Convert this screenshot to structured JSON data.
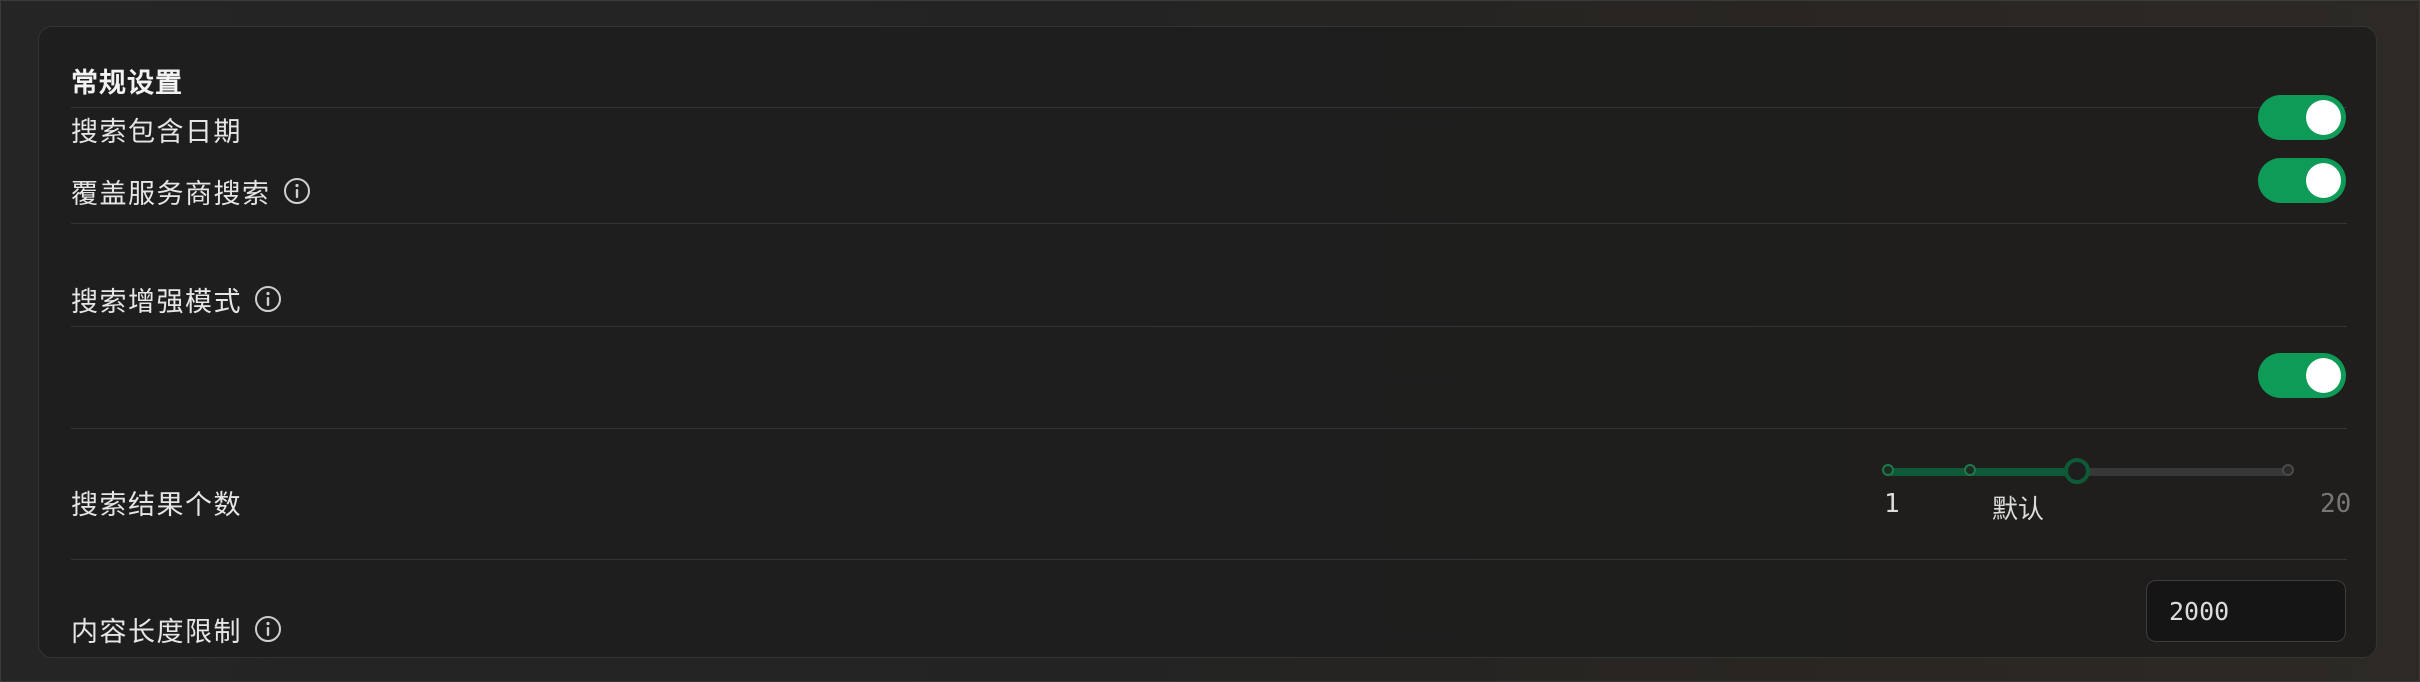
{
  "section": {
    "title": "常规设置"
  },
  "settings": {
    "include_date": {
      "label": "搜索包含日期",
      "enabled": true
    },
    "override_provider": {
      "label": "覆盖服务商搜索",
      "enabled": true
    },
    "enhanced_mode": {
      "label": "搜索增强模式",
      "enabled": true
    },
    "result_count": {
      "label": "搜索结果个数",
      "min_label": "1",
      "default_label": "默认",
      "max_label": "20",
      "slider_fraction": 0.47
    },
    "content_length": {
      "label": "内容长度限制",
      "value": "2000"
    }
  },
  "colors": {
    "accent": "#0e9a57",
    "slider_fill": "#0f5a36",
    "background": "#1e1e1e"
  },
  "icons": {
    "info": "info-circle-icon"
  }
}
